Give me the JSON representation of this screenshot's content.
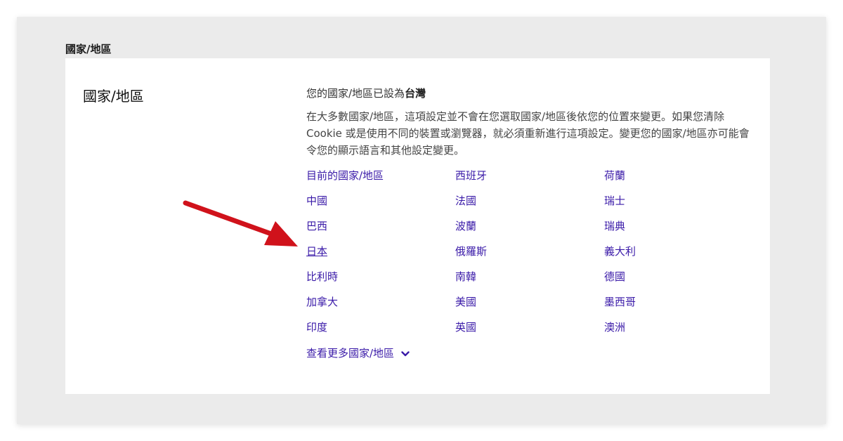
{
  "section_label": "國家/地區",
  "card": {
    "title": "國家/地區",
    "current_prefix": "您的國家/地區已設為",
    "current_value": "台灣",
    "description": "在大多數國家/地區，這項設定並不會在您選取國家/地區後依您的位置來變更。如果您清除 Cookie 或是使用不同的裝置或瀏覽器，就必須重新進行這項設定。變更您的國家/地區亦可能會令您的顯示語言和其他設定變更。",
    "countries": {
      "col1": [
        "目前的國家/地區",
        "中國",
        "巴西",
        "日本",
        "比利時",
        "加拿大",
        "印度"
      ],
      "col2": [
        "西班牙",
        "法國",
        "波蘭",
        "俄羅斯",
        "南韓",
        "美國",
        "英國"
      ],
      "col3": [
        "荷蘭",
        "瑞士",
        "瑞典",
        "義大利",
        "德國",
        "墨西哥",
        "澳洲"
      ]
    },
    "more_label": "查看更多國家/地區"
  },
  "icons": {
    "more": "chevron-down-icon",
    "annotation": "red-arrow-icon"
  },
  "colors": {
    "link": "#3a1aa8",
    "arrow": "#d0121b",
    "panel_bg": "#ebebeb"
  }
}
